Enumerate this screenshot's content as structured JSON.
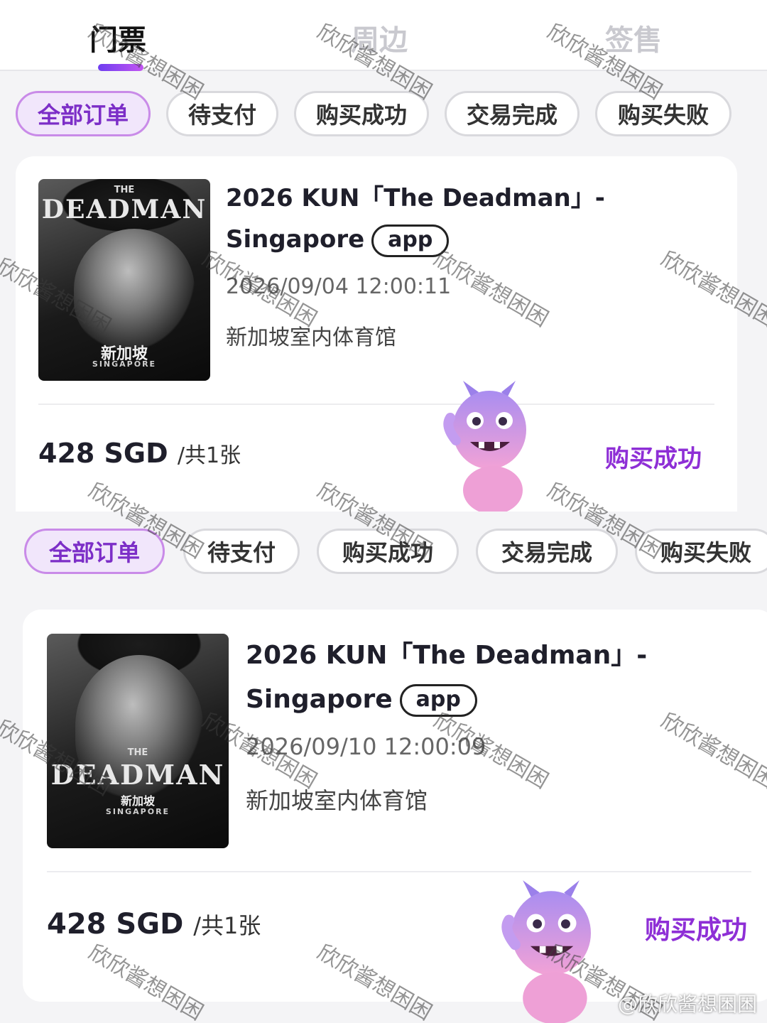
{
  "top_tabs": [
    {
      "label": "门票",
      "active": true
    },
    {
      "label": "周边",
      "active": false
    },
    {
      "label": "签售",
      "active": false
    }
  ],
  "filters_1": [
    "全部订单",
    "待支付",
    "购买成功",
    "交易完成",
    "购买失败"
  ],
  "filters_2": [
    "全部订单",
    "待支付",
    "购买成功",
    "交易完成",
    "购买失败"
  ],
  "orders": [
    {
      "title_line1": "2026 KUN「The Deadman」-",
      "title_line2": "Singapore",
      "badge": "app",
      "datetime": "2026/09/04 12:00:11",
      "venue": "新加坡室内体育馆",
      "price": "428 SGD",
      "quantity": "/共1张",
      "status": "购买成功",
      "poster": {
        "the": "THE",
        "title": "DEADMAN",
        "city": "新加坡",
        "sub": "SINGAPORE"
      }
    },
    {
      "title_line1": "2026 KUN「The Deadman」-",
      "title_line2": "Singapore",
      "badge": "app",
      "datetime": "2026/09/10 12:00:09",
      "venue": "新加坡室内体育馆",
      "price": "428 SGD",
      "quantity": "/共1张",
      "status": "购买成功",
      "poster": {
        "the": "THE",
        "title": "DEADMAN",
        "city": "新加坡",
        "sub": "SINGAPORE"
      }
    }
  ],
  "watermark": "欣欣酱想困困",
  "weibo_handle": "@欣欣酱想困困",
  "colors": {
    "accent": "#8e2fd6",
    "chip_active_bg": "#f1e6fb",
    "indicator": "#6e3df0"
  }
}
